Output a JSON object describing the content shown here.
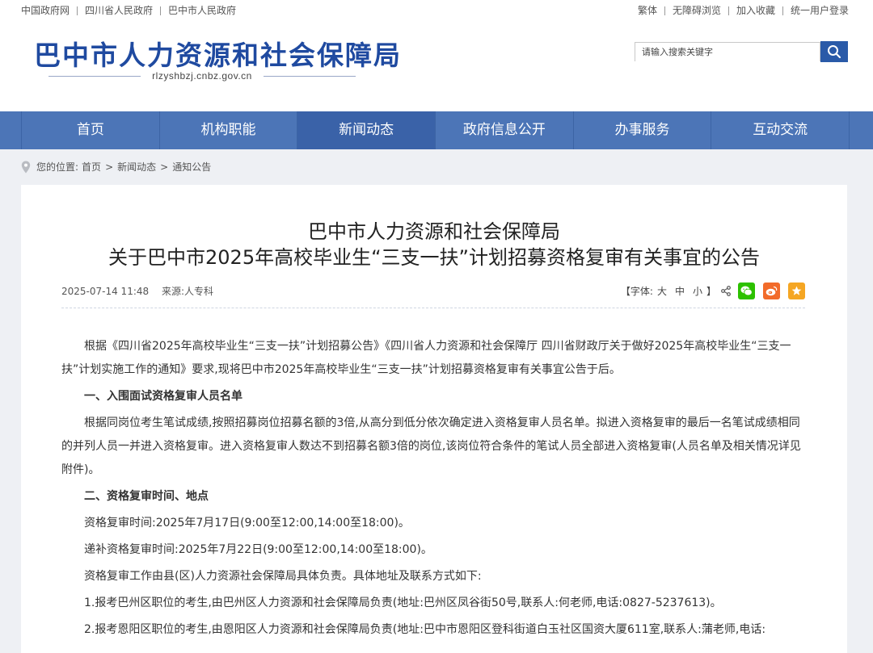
{
  "top_links_left": [
    "中国政府网",
    "四川省人民政府",
    "巴中市人民政府"
  ],
  "top_links_right": [
    "繁体",
    "无障碍浏览",
    "加入收藏",
    "统一用户登录"
  ],
  "site": {
    "title": "巴中市人力资源和社会保障局",
    "domain": "rlzyshbzj.cnbz.gov.cn"
  },
  "search": {
    "placeholder": "请输入搜索关键字",
    "icon": "search-icon"
  },
  "nav": [
    "首页",
    "机构职能",
    "新闻动态",
    "政府信息公开",
    "办事服务",
    "互动交流"
  ],
  "nav_active_index": 2,
  "breadcrumb": {
    "label": "您的位置:",
    "items": [
      "首页",
      "新闻动态",
      "通知公告"
    ]
  },
  "article": {
    "title_line1": "巴中市人力资源和社会保障局",
    "title_line2": "关于巴中市2025年高校毕业生“三支一扶”计划招募资格复审有关事宜的公告",
    "date": "2025-07-14 11:48",
    "source": "来源:人专科",
    "font_size": {
      "open": "【字体:",
      "large": "大",
      "medium": "中",
      "small": "小",
      "close": "】"
    },
    "share_icons": [
      "share-icon",
      "wechat-icon",
      "weibo-icon",
      "favorite-star-icon"
    ],
    "paragraphs": [
      "根据《四川省2025年高校毕业生“三支一扶”计划招募公告》《四川省人力资源和社会保障厅 四川省财政厅关于做好2025年高校毕业生“三支一扶”计划实施工作的通知》要求,现将巴中市2025年高校毕业生“三支一扶”计划招募资格复审有关事宜公告于后。",
      "一、入围面试资格复审人员名单",
      "根据同岗位考生笔试成绩,按照招募岗位招募名额的3倍,从高分到低分依次确定进入资格复审人员名单。拟进入资格复审的最后一名笔试成绩相同的并列人员一并进入资格复审。进入资格复审人数达不到招募名额3倍的岗位,该岗位符合条件的笔试人员全部进入资格复审(人员名单及相关情况详见附件)。",
      "二、资格复审时间、地点",
      "资格复审时间:2025年7月17日(9:00至12:00,14:00至18:00)。",
      "递补资格复审时间:2025年7月22日(9:00至12:00,14:00至18:00)。",
      "资格复审工作由县(区)人力资源社会保障局具体负责。具体地址及联系方式如下:",
      "1.报考巴州区职位的考生,由巴州区人力资源和社会保障局负责(地址:巴州区凤谷街50号,联系人:何老师,电话:0827-5237613)。",
      "2.报考恩阳区职位的考生,由恩阳区人力资源和社会保障局负责(地址:巴中市恩阳区登科街道白玉社区国资大厦611室,联系人:蒲老师,电话:"
    ],
    "heading_indexes": [
      1,
      3
    ]
  },
  "colors": {
    "nav_bg": "#4c75b7",
    "nav_active": "#3a62a8",
    "title_blue": "#1f4aa0",
    "wechat": "#2dc100",
    "weibo": "#f26b2a",
    "favorite": "#f5a623"
  }
}
